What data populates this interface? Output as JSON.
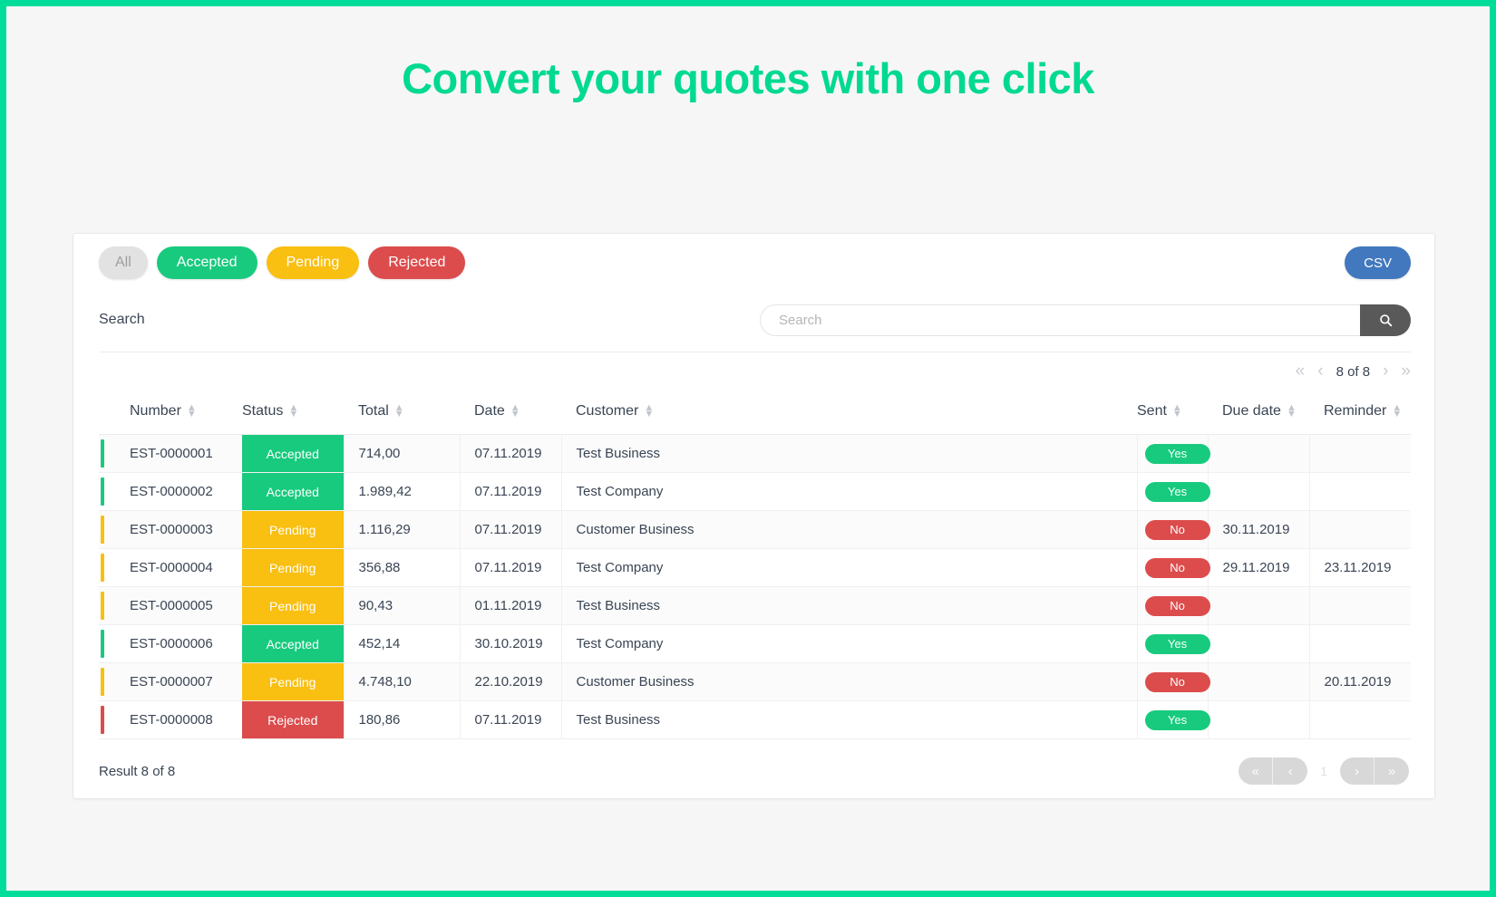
{
  "hero": {
    "title": "Convert your quotes with one click"
  },
  "colors": {
    "brand_green": "#00DC9A",
    "accepted": "#18ca7e",
    "pending": "#f9bf11",
    "rejected": "#dc4c4c",
    "csv_blue": "#4178be",
    "all_gray": "#e2e2e2"
  },
  "filters": [
    {
      "label": "All",
      "state": "inactive"
    },
    {
      "label": "Accepted",
      "state": "accepted"
    },
    {
      "label": "Pending",
      "state": "pending"
    },
    {
      "label": "Rejected",
      "state": "rejected"
    }
  ],
  "export": {
    "label": "CSV"
  },
  "search": {
    "label": "Search",
    "placeholder": "Search",
    "value": "",
    "button_icon": "search-icon"
  },
  "top_pager": {
    "first_icon": "«",
    "prev_icon": "‹",
    "text": "8 of 8",
    "next_icon": "›",
    "last_icon": "»"
  },
  "table": {
    "columns": [
      {
        "label": "Number"
      },
      {
        "label": "Status"
      },
      {
        "label": "Total"
      },
      {
        "label": "Date"
      },
      {
        "label": "Customer"
      },
      {
        "label": "Sent"
      },
      {
        "label": "Due date"
      },
      {
        "label": "Reminder"
      }
    ],
    "rows": [
      {
        "number": "EST-0000001",
        "status": "Accepted",
        "status_key": "accepted",
        "total": "714,00",
        "date": "07.11.2019",
        "customer": "Test Business",
        "sent": "Yes",
        "sent_key": "yes",
        "due_date": "",
        "reminder": ""
      },
      {
        "number": "EST-0000002",
        "status": "Accepted",
        "status_key": "accepted",
        "total": "1.989,42",
        "date": "07.11.2019",
        "customer": "Test Company",
        "sent": "Yes",
        "sent_key": "yes",
        "due_date": "",
        "reminder": ""
      },
      {
        "number": "EST-0000003",
        "status": "Pending",
        "status_key": "pending",
        "total": "1.116,29",
        "date": "07.11.2019",
        "customer": "Customer Business",
        "sent": "No",
        "sent_key": "no",
        "due_date": "30.11.2019",
        "reminder": ""
      },
      {
        "number": "EST-0000004",
        "status": "Pending",
        "status_key": "pending",
        "total": "356,88",
        "date": "07.11.2019",
        "customer": "Test Company",
        "sent": "No",
        "sent_key": "no",
        "due_date": "29.11.2019",
        "reminder": "23.11.2019"
      },
      {
        "number": "EST-0000005",
        "status": "Pending",
        "status_key": "pending",
        "total": "90,43",
        "date": "01.11.2019",
        "customer": "Test Business",
        "sent": "No",
        "sent_key": "no",
        "due_date": "",
        "reminder": ""
      },
      {
        "number": "EST-0000006",
        "status": "Accepted",
        "status_key": "accepted",
        "total": "452,14",
        "date": "30.10.2019",
        "customer": "Test Company",
        "sent": "Yes",
        "sent_key": "yes",
        "due_date": "",
        "reminder": ""
      },
      {
        "number": "EST-0000007",
        "status": "Pending",
        "status_key": "pending",
        "total": "4.748,10",
        "date": "22.10.2019",
        "customer": "Customer Business",
        "sent": "No",
        "sent_key": "no",
        "due_date": "",
        "reminder": "20.11.2019"
      },
      {
        "number": "EST-0000008",
        "status": "Rejected",
        "status_key": "rejected",
        "total": "180,86",
        "date": "07.11.2019",
        "customer": "Test Business",
        "sent": "Yes",
        "sent_key": "yes",
        "due_date": "",
        "reminder": ""
      }
    ]
  },
  "footer": {
    "result_text": "Result 8 of 8",
    "first_icon": "«",
    "prev_icon": "‹",
    "page_number": "1",
    "next_icon": "›",
    "last_icon": "»"
  }
}
